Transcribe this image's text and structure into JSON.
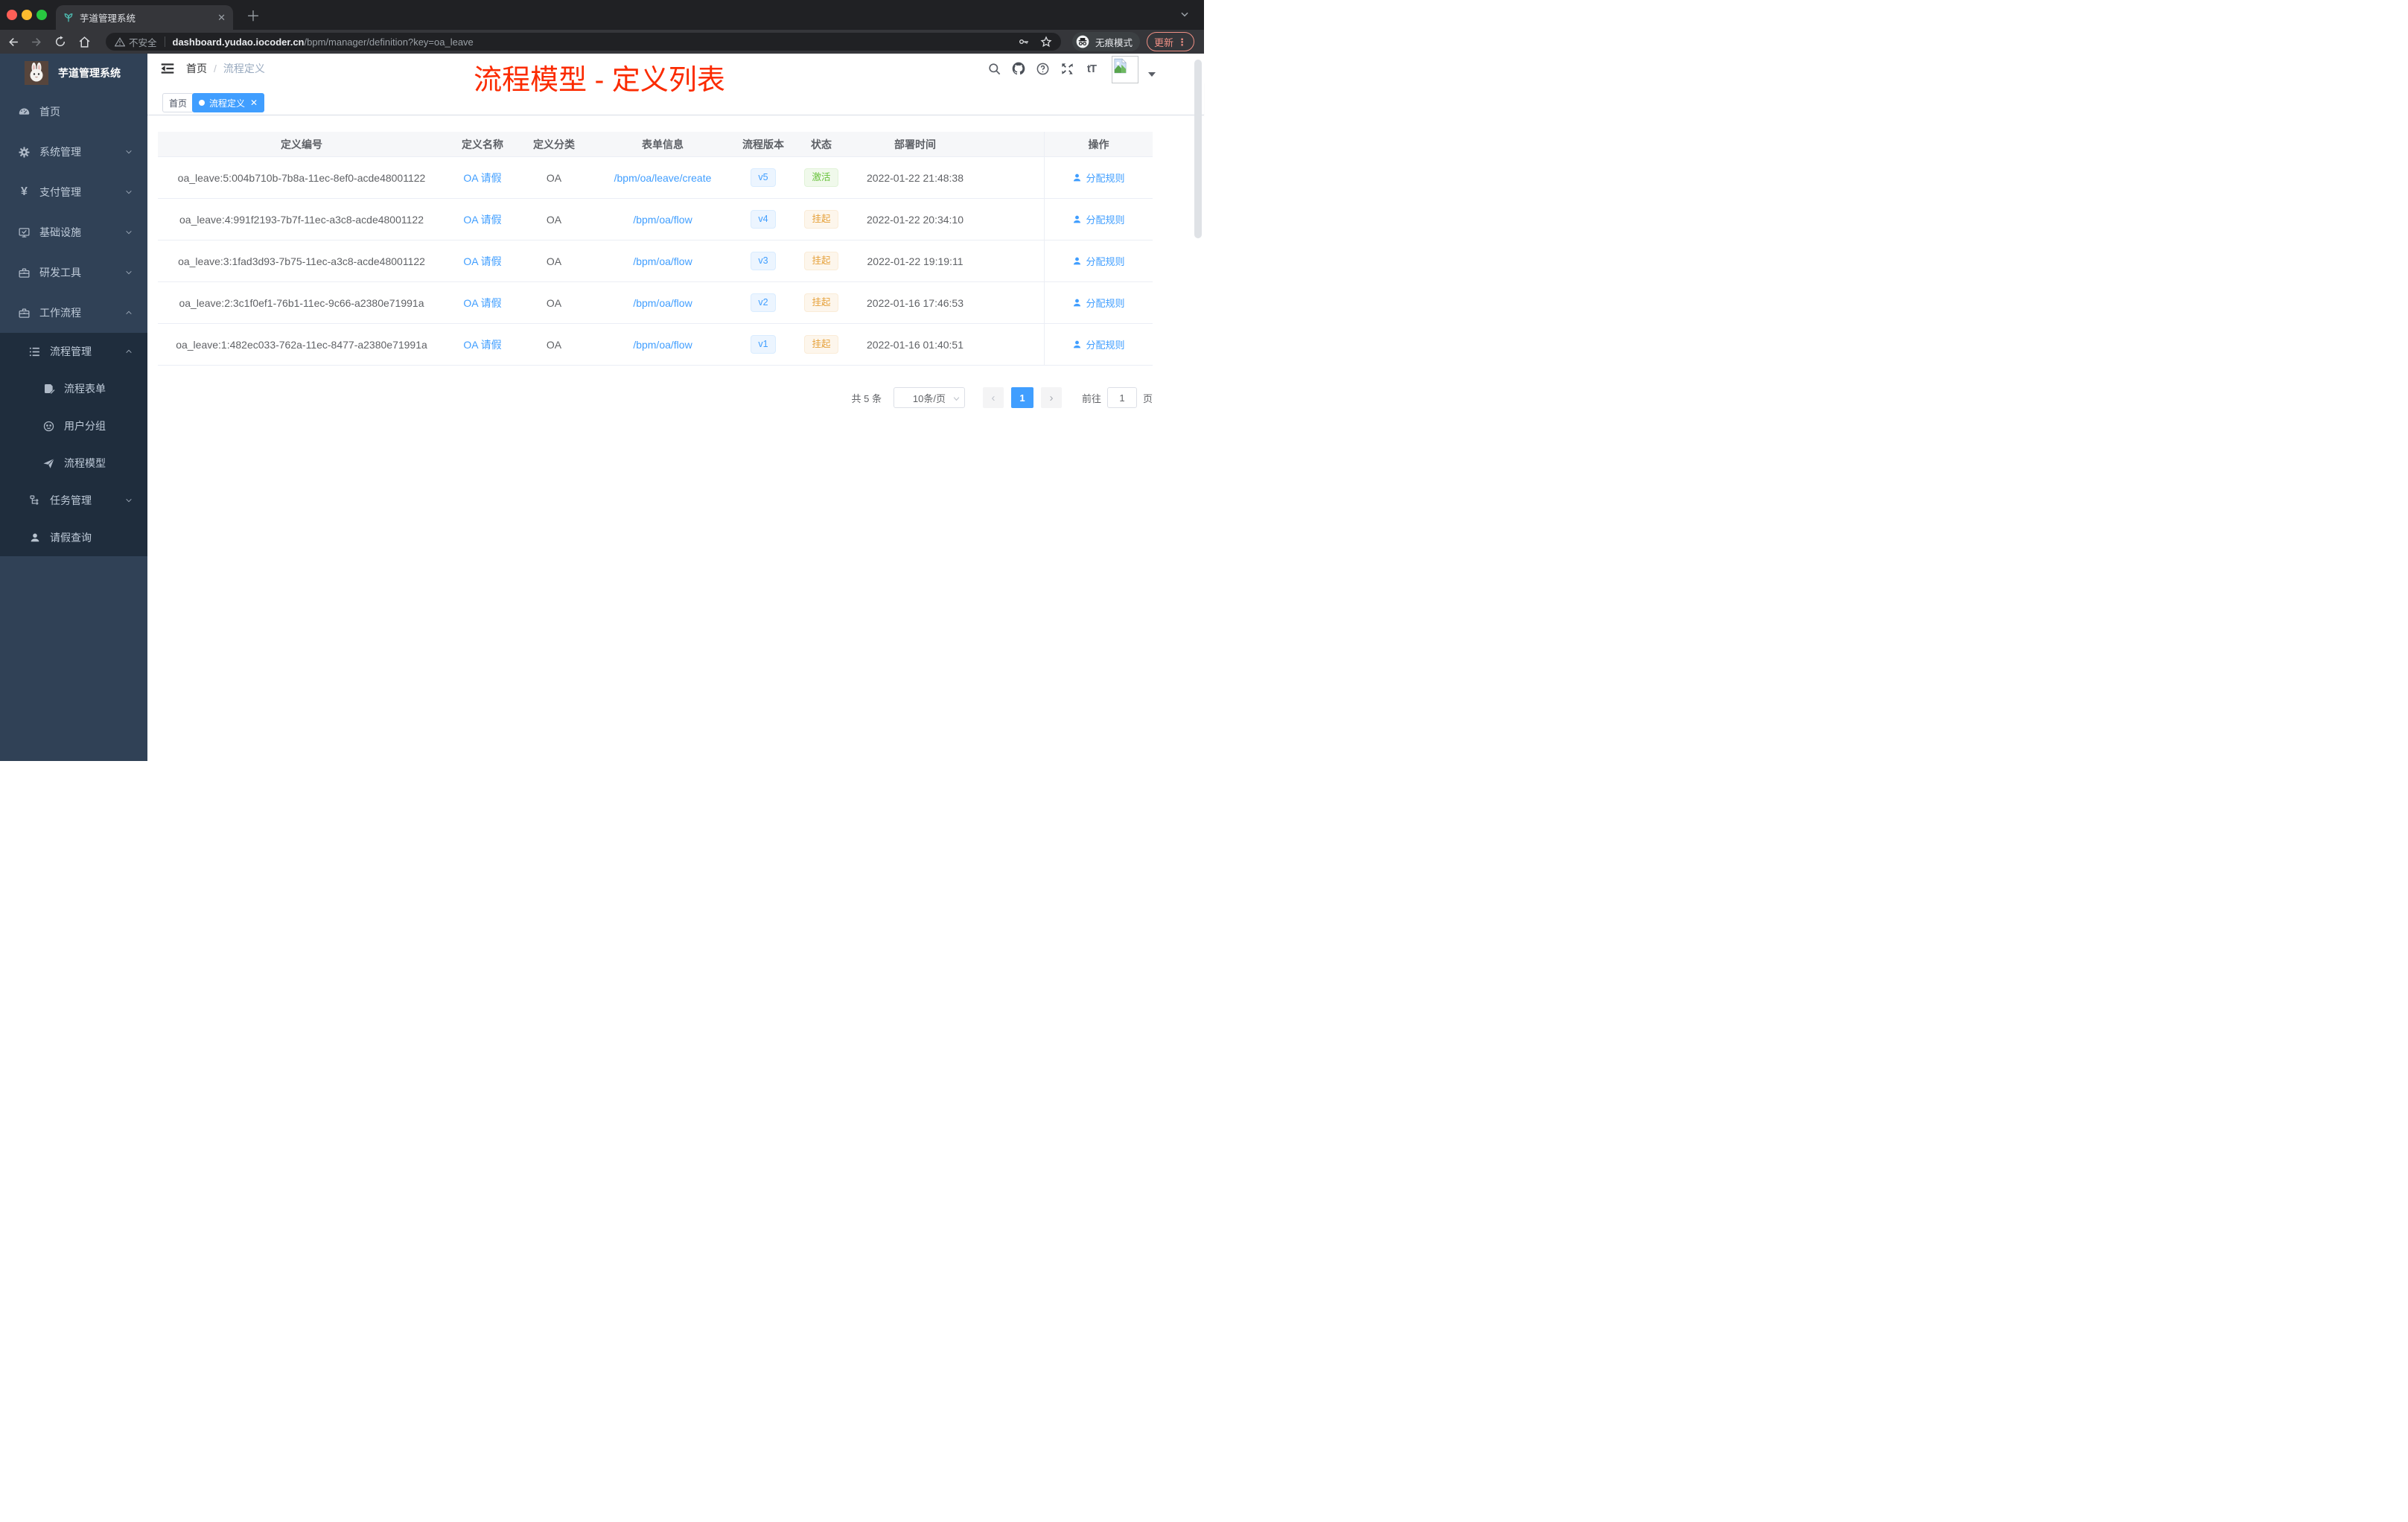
{
  "browser": {
    "tab_title": "芋道管理系统",
    "security_label": "不安全",
    "url_host": "dashboard.yudao.iocoder.cn",
    "url_path": "/bpm/manager/definition?key=oa_leave",
    "incognito_label": "无痕模式",
    "update_label": "更新"
  },
  "header": {
    "breadcrumb_home": "首页",
    "breadcrumb_current": "流程定义",
    "overlay_title": "流程模型 - 定义列表"
  },
  "tags": {
    "home": "首页",
    "active": "流程定义"
  },
  "sidebar": {
    "logo_title": "芋道管理系统",
    "items": [
      {
        "label": "首页",
        "icon": "dashboard-icon",
        "chevron": ""
      },
      {
        "label": "系统管理",
        "icon": "gear-icon",
        "chevron": "down"
      },
      {
        "label": "支付管理",
        "icon": "yen-icon",
        "chevron": "down"
      },
      {
        "label": "基础设施",
        "icon": "monitor-icon",
        "chevron": "down"
      },
      {
        "label": "研发工具",
        "icon": "toolbox-icon",
        "chevron": "down"
      },
      {
        "label": "工作流程",
        "icon": "briefcase-icon",
        "chevron": "up"
      },
      {
        "label": "流程管理",
        "icon": "list-icon",
        "chevron": "up"
      },
      {
        "label": "流程表单",
        "icon": "form-icon",
        "chevron": ""
      },
      {
        "label": "用户分组",
        "icon": "robot-icon",
        "chevron": ""
      },
      {
        "label": "流程模型",
        "icon": "send-icon",
        "chevron": ""
      },
      {
        "label": "任务管理",
        "icon": "tree-icon",
        "chevron": "down"
      },
      {
        "label": "请假查询",
        "icon": "user-icon",
        "chevron": ""
      }
    ]
  },
  "table": {
    "columns": [
      "定义编号",
      "定义名称",
      "定义分类",
      "表单信息",
      "流程版本",
      "状态",
      "部署时间",
      "操作"
    ],
    "action_label": "分配规则",
    "rows": [
      {
        "id": "oa_leave:5:004b710b-7b8a-11ec-8ef0-acde48001122",
        "name": "OA 请假",
        "category": "OA",
        "form": "/bpm/oa/leave/create",
        "version": "v5",
        "status": "激活",
        "status_class": "success",
        "time": "2022-01-22 21:48:38"
      },
      {
        "id": "oa_leave:4:991f2193-7b7f-11ec-a3c8-acde48001122",
        "name": "OA 请假",
        "category": "OA",
        "form": "/bpm/oa/flow",
        "version": "v4",
        "status": "挂起",
        "status_class": "warning",
        "time": "2022-01-22 20:34:10"
      },
      {
        "id": "oa_leave:3:1fad3d93-7b75-11ec-a3c8-acde48001122",
        "name": "OA 请假",
        "category": "OA",
        "form": "/bpm/oa/flow",
        "version": "v3",
        "status": "挂起",
        "status_class": "warning",
        "time": "2022-01-22 19:19:11"
      },
      {
        "id": "oa_leave:2:3c1f0ef1-76b1-11ec-9c66-a2380e71991a",
        "name": "OA 请假",
        "category": "OA",
        "form": "/bpm/oa/flow",
        "version": "v2",
        "status": "挂起",
        "status_class": "warning",
        "time": "2022-01-16 17:46:53"
      },
      {
        "id": "oa_leave:1:482ec033-762a-11ec-8477-a2380e71991a",
        "name": "OA 请假",
        "category": "OA",
        "form": "/bpm/oa/flow",
        "version": "v1",
        "status": "挂起",
        "status_class": "warning",
        "time": "2022-01-16 01:40:51"
      }
    ]
  },
  "pagination": {
    "total": "共 5 条",
    "page_size": "10条/页",
    "prev": "‹",
    "current": "1",
    "next": "›",
    "goto_prefix": "前往",
    "goto_value": "1",
    "goto_suffix": "页"
  },
  "colors": {
    "accent": "#409eff",
    "success": "#67c23a",
    "warning": "#e6a23c",
    "title_red": "#fb2b00",
    "sidebar_bg": "#304156",
    "submenu_bg": "#1f2d3d"
  }
}
